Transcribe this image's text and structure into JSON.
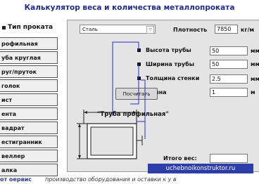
{
  "app_title": "Калькулятор веса и количества металлопроката",
  "sidebar": {
    "header": "Тип проката",
    "items": [
      "рофильная",
      "уба круглая",
      "руг/пруток",
      "голок",
      "ист",
      "ента",
      "вадрат",
      "естигранник",
      "веллер",
      "алка"
    ]
  },
  "material": {
    "selected": "Сталь",
    "arrow": "▽"
  },
  "density": {
    "label": "Плотность",
    "value": "7850",
    "unit": "кг/м"
  },
  "fields": [
    {
      "label": "Высота трубы",
      "value": "50",
      "unit": "мм"
    },
    {
      "label": "Ширина трубы",
      "value": "50",
      "unit": "мм"
    },
    {
      "label": "Толщина стенки",
      "value": "2.5",
      "unit": "мм"
    },
    {
      "label": "Длина",
      "value": "1",
      "unit": "м"
    }
  ],
  "calc_button": "Посчитать",
  "shape_name": "\"Труба профильная\"",
  "total": {
    "label": "Итого вес:",
    "value": ""
  },
  "watermark": "uchebnoikonstruktor.ru",
  "footer": {
    "left": "от оервис",
    "right": "производство оборудования и оставки к у в"
  }
}
